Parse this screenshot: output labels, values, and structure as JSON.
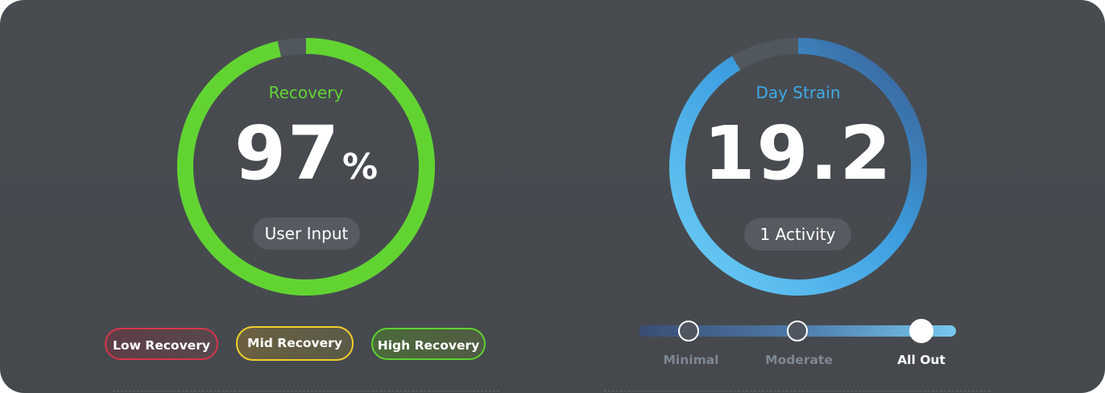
{
  "recovery": {
    "label": "Recovery",
    "value": "97",
    "unit": "%",
    "percent": 97,
    "source_label": "User Input",
    "ring_color": "#62d432",
    "track_color": "#51575e",
    "legend": [
      {
        "label": "Low Recovery",
        "color": "#d6354a"
      },
      {
        "label": "Mid Recovery",
        "color": "#f0cf2b"
      },
      {
        "label": "High Recovery",
        "color": "#5ed130"
      }
    ]
  },
  "strain": {
    "label": "Day Strain",
    "value": "19.2",
    "activity_label": "1 Activity",
    "ring_start_color": "#6fd0f8",
    "ring_end_color": "#3a5a8e",
    "track_color": "#51575e",
    "scale": {
      "stops": [
        "Minimal",
        "Moderate",
        "All Out"
      ],
      "selected": "All Out"
    }
  },
  "colors": {
    "background": "#46494f",
    "recovery_accent": "#62d432",
    "strain_accent": "#3da9e8"
  }
}
